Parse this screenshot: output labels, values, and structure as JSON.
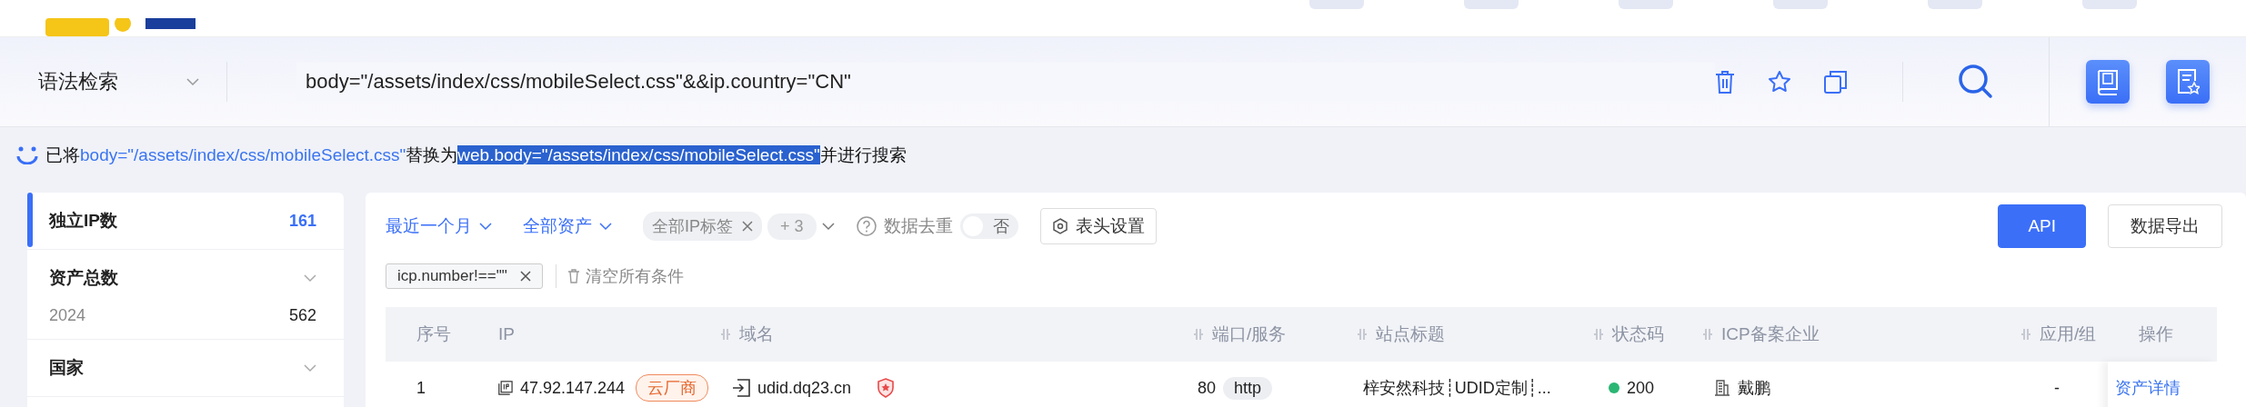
{
  "search": {
    "mode": "语法检索",
    "query": "body=\"/assets/index/css/mobileSelect.css\"&&ip.country=\"CN\""
  },
  "notice": [
    {
      "kind": "plain",
      "text": "已将"
    },
    {
      "kind": "link",
      "text": "body=\"/assets/index/css/mobileSelect.css\""
    },
    {
      "kind": "plain",
      "text": "替换为"
    },
    {
      "kind": "highlight",
      "text": "web.body=\"/assets/index/css/mobileSelect.css\""
    },
    {
      "kind": "plain",
      "text": "并进行搜索"
    }
  ],
  "sidebar": [
    {
      "title": "独立IP数",
      "count": "161",
      "selected": true
    },
    {
      "title": "资产总数",
      "selected": false,
      "items": [
        {
          "label": "2024",
          "count": "562"
        }
      ]
    },
    {
      "title": "国家",
      "selected": false
    }
  ],
  "filters": [
    {
      "label": "最近一个月"
    },
    {
      "label": "全部资产"
    }
  ],
  "tag_select": {
    "tags": [
      "全部IP标签"
    ],
    "more": "+ 3"
  },
  "dedupe": {
    "label": "数据去重",
    "on": false,
    "state_text": "否"
  },
  "column_settings": "表头设置",
  "buttons": [
    {
      "label": "API",
      "primary": true
    },
    {
      "label": "数据导出",
      "primary": false
    }
  ],
  "conditions": [
    "icp.number!==\"\""
  ],
  "clear_all": "清空所有条件",
  "table": {
    "columns": [
      {
        "label": "序号",
        "resizable": false
      },
      {
        "label": "IP",
        "resizable": false
      },
      {
        "label": "域名",
        "resizable": true
      },
      {
        "label": "端口/服务",
        "resizable": true
      },
      {
        "label": "站点标题",
        "resizable": true
      },
      {
        "label": "状态码",
        "resizable": true
      },
      {
        "label": "ICP备案企业",
        "resizable": true
      },
      {
        "label": "应用/组",
        "resizable": true
      },
      {
        "label": "操作",
        "resizable": false
      }
    ],
    "rows": [
      {
        "index": "1",
        "ip": "47.92.147.244",
        "ip_tag": "云厂商",
        "domain": "udid.dq23.cn",
        "port": "80",
        "protocol": "http",
        "title": "梓安然科技┊UDID定制┊...",
        "status": {
          "text": "200",
          "color": "#2bb673"
        },
        "icp": "戴鹏",
        "app": "-",
        "action": "资产详情"
      }
    ]
  }
}
